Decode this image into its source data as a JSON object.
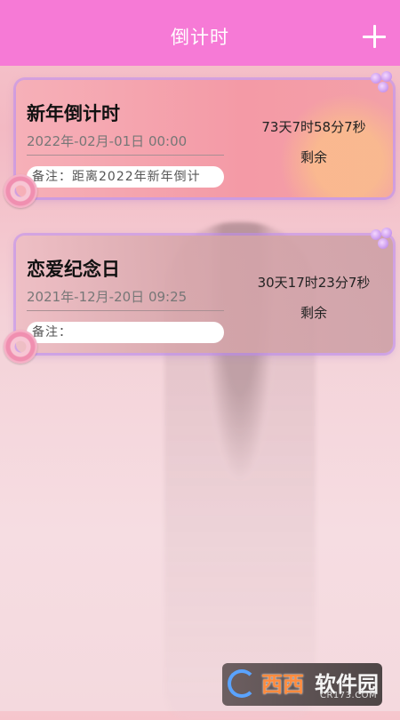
{
  "header": {
    "title": "倒计时",
    "add_icon": "plus-icon"
  },
  "events": [
    {
      "title": "新年倒计时",
      "date": "2022年-02月-01日 00:00",
      "note": "备注：距离2022年新年倒计",
      "remaining_time": "73天7时58分7秒",
      "remaining_label": "剩余"
    },
    {
      "title": "恋爱纪念日",
      "date": "2021年-12月-20日 09:25",
      "note": "备注：",
      "remaining_time": "30天17时23分7秒",
      "remaining_label": "剩余"
    }
  ],
  "watermark": {
    "brand_a": "西西",
    "brand_b": "软件园",
    "domain": "CR173.COM"
  },
  "colors": {
    "header": "#f67ad6",
    "card_border": "#bd8cf0"
  }
}
